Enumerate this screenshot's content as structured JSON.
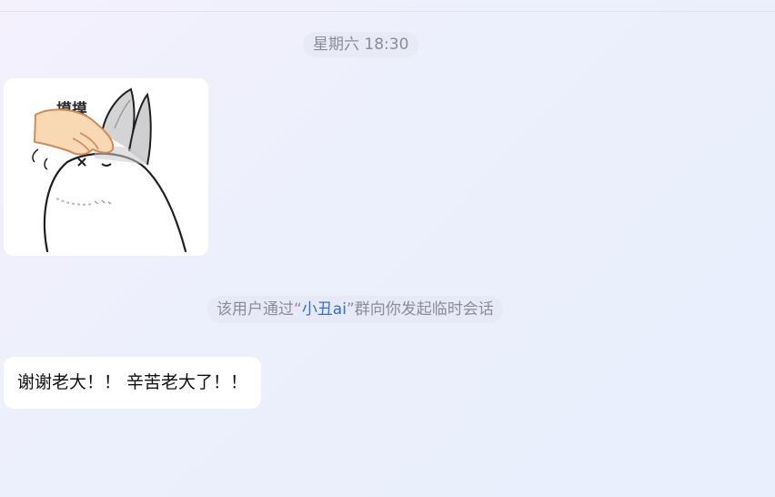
{
  "chat": {
    "timestamp": "星期六 18:30",
    "sticker": {
      "icon": "rabbit-pat-sticker",
      "caption": "摸摸"
    },
    "system_notice": {
      "prefix": "该用户通过“",
      "group_name": "小丑ai",
      "suffix": "”群向你发起临时会话"
    },
    "message_text": "谢谢老大！！ 辛苦老大了！！"
  },
  "colors": {
    "background": "#eceffc",
    "bubble": "#ffffff",
    "meta_text": "#8a8d99",
    "link": "#2f6fd6",
    "message_text": "#111111"
  }
}
